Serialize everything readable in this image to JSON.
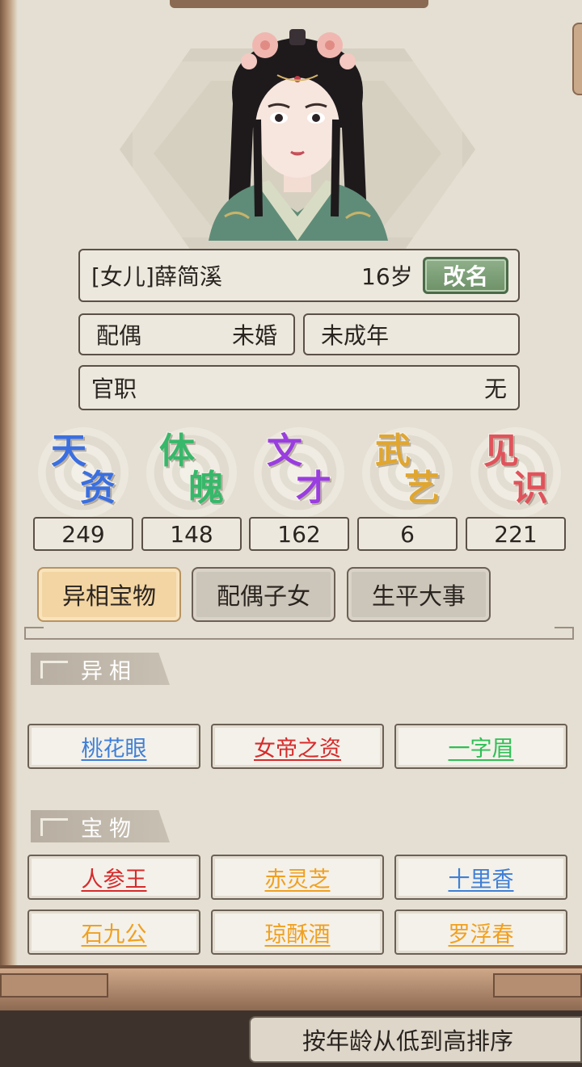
{
  "character": {
    "title": "[女儿]薛简溪",
    "age": "16岁",
    "rename_label": "改名",
    "spouse_label": "配偶",
    "spouse_value": "未婚",
    "adult_status": "未成年",
    "office_label": "官职",
    "office_value": "无"
  },
  "stats": [
    {
      "c1": "天",
      "c2": "资",
      "value": "249",
      "color": "#3b6fe0",
      "icon": "talent-calligraphy"
    },
    {
      "c1": "体",
      "c2": "魄",
      "value": "148",
      "color": "#37b86a",
      "icon": "physique-calligraphy"
    },
    {
      "c1": "文",
      "c2": "才",
      "value": "162",
      "color": "#9a3de0",
      "icon": "literary-calligraphy"
    },
    {
      "c1": "武",
      "c2": "艺",
      "value": "6",
      "color": "#e0a62f",
      "icon": "martial-calligraphy"
    },
    {
      "c1": "见",
      "c2": "识",
      "value": "221",
      "color": "#e0535b",
      "icon": "insight-calligraphy"
    }
  ],
  "tabs": [
    {
      "label": "异相宝物",
      "active": true
    },
    {
      "label": "配偶子女",
      "active": false
    },
    {
      "label": "生平大事",
      "active": false
    }
  ],
  "traits_section": {
    "title": "异相",
    "items": [
      {
        "label": "桃花眼",
        "color": "#3f7fd6"
      },
      {
        "label": "女帝之资",
        "color": "#d62b2b"
      },
      {
        "label": "一字眉",
        "color": "#2fbf55"
      }
    ]
  },
  "treasures_section": {
    "title": "宝物",
    "items": [
      {
        "label": "人参王",
        "color": "#d62b2b"
      },
      {
        "label": "赤灵芝",
        "color": "#f0a020"
      },
      {
        "label": "十里香",
        "color": "#3f7fd6"
      },
      {
        "label": "石九公",
        "color": "#f0a020"
      },
      {
        "label": "琼酥酒",
        "color": "#f0a020"
      },
      {
        "label": "罗浮春",
        "color": "#f0a020"
      }
    ]
  },
  "sort_bar": {
    "label": "按年龄从低到高排序"
  }
}
